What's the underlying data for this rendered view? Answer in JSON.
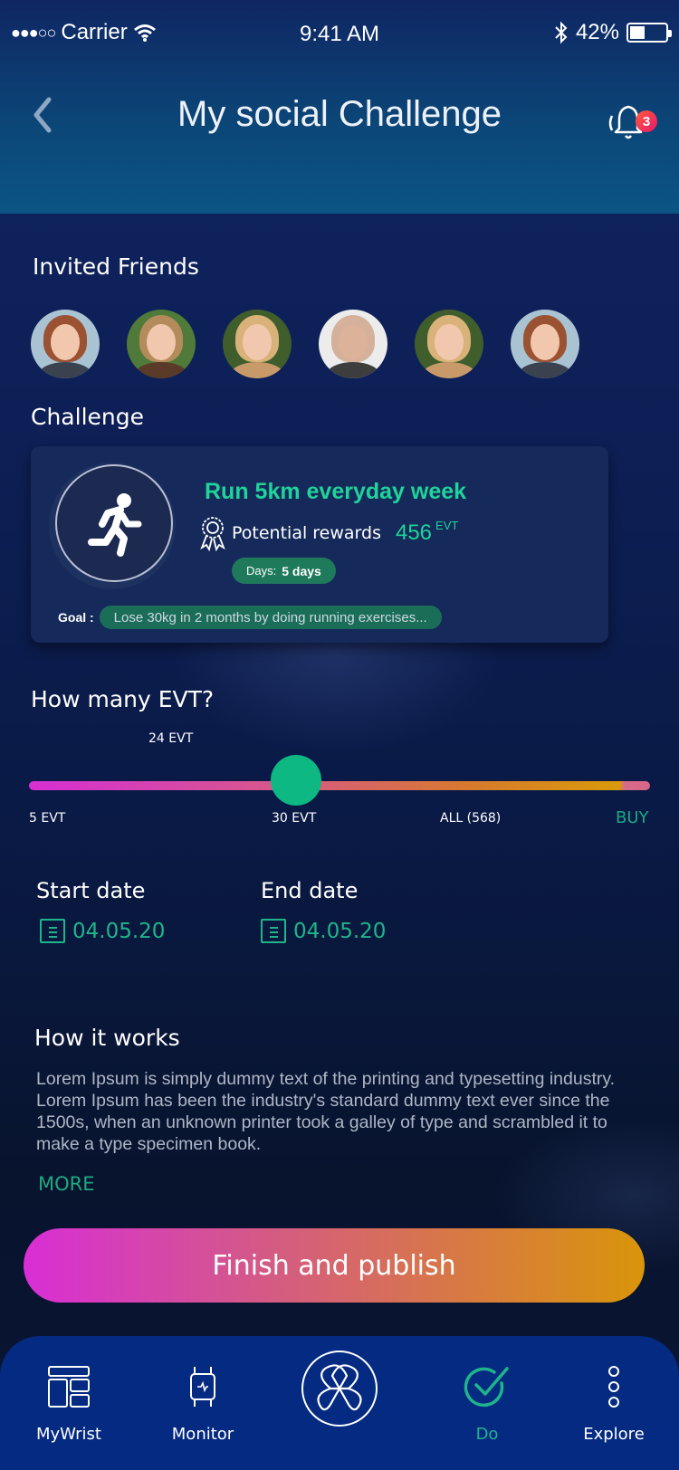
{
  "status_bar": {
    "signal": "●●●○○",
    "carrier": "Carrier",
    "time": "9:41 AM",
    "battery_percent": "42%",
    "battery_level": 0.42
  },
  "header": {
    "title": "My social Challenge",
    "back_icon": "chevron-left-icon",
    "notification_icon": "bell-icon",
    "notification_count": "3"
  },
  "invited_friends": {
    "title": "Invited Friends",
    "avatars": [
      {
        "name": "friend-1"
      },
      {
        "name": "friend-2"
      },
      {
        "name": "friend-3"
      },
      {
        "name": "friend-4"
      },
      {
        "name": "friend-5"
      },
      {
        "name": "friend-6"
      }
    ]
  },
  "challenge": {
    "section_title": "Challenge",
    "icon": "running-person-icon",
    "title": "Run 5km everyday week",
    "reward_icon": "award-ribbon-icon",
    "reward_label": "Potential rewards",
    "reward_value": "456",
    "reward_unit": "EVT",
    "days_label": "Days:",
    "days_value": "5 days",
    "goal_label": "Goal :",
    "goal_text": "Lose 30kg in 2 months by doing running exercises..."
  },
  "evt_slider": {
    "title": "How many EVT?",
    "current_label": "24 EVT",
    "min_label": "5 EVT",
    "mid_label": "30 EVT",
    "max_label": "ALL (568)",
    "buy_label": "BUY",
    "thumb_position_fraction": 0.43
  },
  "dates": {
    "start_label": "Start date",
    "start_value": "04.05.20",
    "end_label": "End date",
    "end_value": "04.05.20",
    "calendar_icon": "calendar-icon"
  },
  "how_it_works": {
    "title": "How it works",
    "body": "Lorem Ipsum is simply dummy text of the printing and typesetting industry. Lorem Ipsum has been the industry's standard dummy text ever since the 1500s, when an unknown printer took a galley of type and scrambled it to make a type specimen book.",
    "more_label": "MORE"
  },
  "primary_action": {
    "label": "Finish and publish"
  },
  "tab_bar": {
    "items": [
      {
        "label": "MyWrist",
        "icon": "dashboard-layout-icon",
        "active": false
      },
      {
        "label": "Monitor",
        "icon": "smartwatch-icon",
        "active": false
      },
      {
        "label": "",
        "icon": "app-logo-icon",
        "active": false
      },
      {
        "label": "Do",
        "icon": "check-circle-icon",
        "active": true
      },
      {
        "label": "Explore",
        "icon": "more-vertical-icon",
        "active": false
      }
    ]
  },
  "colors": {
    "accent_green": "#1fd39a",
    "slider_thumb": "#0db883",
    "gradient_start": "#d82ed5",
    "gradient_end": "#d9950a",
    "tabbar_bg": "#042a82",
    "badge": "#e8186e"
  }
}
